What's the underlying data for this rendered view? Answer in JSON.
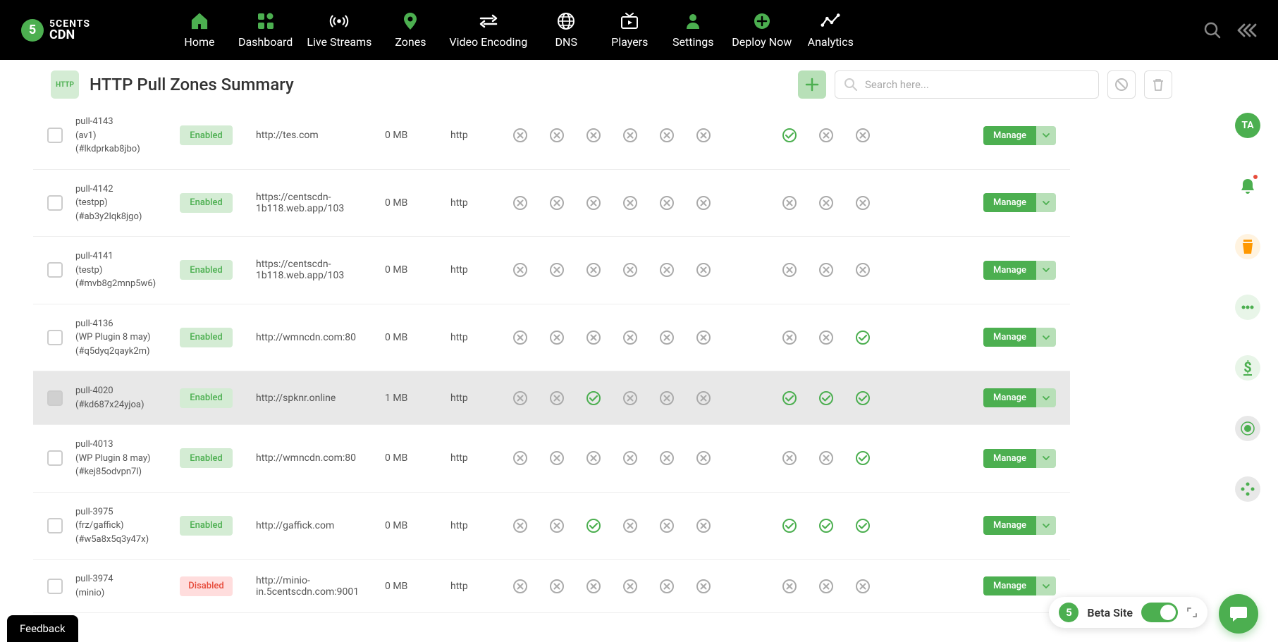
{
  "brand": {
    "name_top": "5CENTS",
    "name_bottom": "CDN",
    "glyph": "5"
  },
  "nav": [
    {
      "label": "Home"
    },
    {
      "label": "Dashboard"
    },
    {
      "label": "Live Streams"
    },
    {
      "label": "Zones"
    },
    {
      "label": "Video Encoding"
    },
    {
      "label": "DNS"
    },
    {
      "label": "Players"
    },
    {
      "label": "Settings"
    },
    {
      "label": "Deploy Now"
    },
    {
      "label": "Analytics"
    }
  ],
  "page": {
    "title": "HTTP Pull Zones Summary",
    "icon_label": "HTTP"
  },
  "search": {
    "placeholder": "Search here..."
  },
  "table": {
    "manage_label": "Manage",
    "rows": [
      {
        "name": "pull-4143",
        "sub": "(av1)",
        "hash": "(#lkdprkab8jbo)",
        "status": "Enabled",
        "origin": "http://tes.com",
        "size": "0 MB",
        "type": "http",
        "states": [
          0,
          0,
          0,
          0,
          0,
          0,
          1,
          0,
          0
        ],
        "hover": false
      },
      {
        "name": "pull-4142",
        "sub": "(testpp)",
        "hash": "(#ab3y2lqk8jgo)",
        "status": "Enabled",
        "origin": "https://centscdn-1b118.web.app/103",
        "size": "0 MB",
        "type": "http",
        "states": [
          0,
          0,
          0,
          0,
          0,
          0,
          0,
          0,
          0
        ],
        "hover": false
      },
      {
        "name": "pull-4141",
        "sub": "(testp)",
        "hash": "(#mvb8g2mnp5w6)",
        "status": "Enabled",
        "origin": "https://centscdn-1b118.web.app/103",
        "size": "0 MB",
        "type": "http",
        "states": [
          0,
          0,
          0,
          0,
          0,
          0,
          0,
          0,
          0
        ],
        "hover": false
      },
      {
        "name": "pull-4136",
        "sub": "(WP Plugin 8 may)",
        "hash": "(#q5dyq2qayk2m)",
        "status": "Enabled",
        "origin": "http://wmncdn.com:80",
        "size": "0 MB",
        "type": "http",
        "states": [
          0,
          0,
          0,
          0,
          0,
          0,
          0,
          0,
          1
        ],
        "hover": false
      },
      {
        "name": "pull-4020",
        "sub": "",
        "hash": "(#kd687x24yjoa)",
        "status": "Enabled",
        "origin": "http://spknr.online",
        "size": "1 MB",
        "type": "http",
        "states": [
          0,
          0,
          1,
          0,
          0,
          0,
          1,
          1,
          1
        ],
        "hover": true
      },
      {
        "name": "pull-4013",
        "sub": "(WP Plugin 8 may)",
        "hash": "(#kej85odvpn7l)",
        "status": "Enabled",
        "origin": "http://wmncdn.com:80",
        "size": "0 MB",
        "type": "http",
        "states": [
          0,
          0,
          0,
          0,
          0,
          0,
          0,
          0,
          1
        ],
        "hover": false
      },
      {
        "name": "pull-3975",
        "sub": "(frz/gaffick)",
        "hash": "(#w5a8x5q3y47x)",
        "status": "Enabled",
        "origin": "http://gaffick.com",
        "size": "0 MB",
        "type": "http",
        "states": [
          0,
          0,
          1,
          0,
          0,
          0,
          1,
          1,
          1
        ],
        "hover": false
      },
      {
        "name": "pull-3974",
        "sub": "(minio)",
        "hash": "",
        "status": "Disabled",
        "origin": "http://minio-in.5centscdn.com:9001",
        "size": "0 MB",
        "type": "http",
        "states": [
          0,
          0,
          0,
          0,
          0,
          0,
          0,
          0,
          0
        ],
        "hover": false
      }
    ]
  },
  "rail": {
    "avatar": "TA"
  },
  "footer": {
    "feedback": "Feedback",
    "beta": "Beta Site"
  }
}
